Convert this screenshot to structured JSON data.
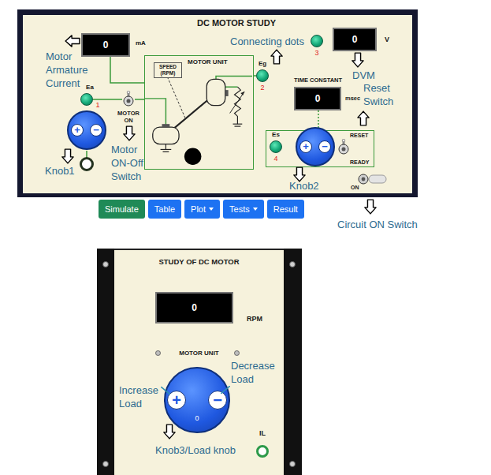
{
  "main_panel": {
    "title": "DC MOTOR STUDY",
    "current_meter": {
      "value": "0",
      "unit": "mA"
    },
    "terminals": [
      {
        "label": "Ea",
        "number": "1"
      },
      {
        "label": "Eg",
        "number": "2"
      },
      {
        "number": "3"
      },
      {
        "label": "Es",
        "number": "4"
      }
    ],
    "motor_switch": {
      "labels": [
        "MOTOR",
        "ON"
      ],
      "on": false
    },
    "armature_knob": {
      "plus": "+",
      "minus": "−"
    },
    "motor_unit": {
      "title": "MOTOR UNIT",
      "speed_label": [
        "SPEED",
        "(RPM)"
      ]
    },
    "dvm": {
      "value": "0",
      "unit": "V"
    },
    "time_constant": {
      "label": "TIME CONSTANT",
      "value": "0",
      "unit": "msec"
    },
    "field_knob": {
      "plus": "+",
      "minus": "−"
    },
    "reset_switch": {
      "labels": [
        "RESET",
        "READY"
      ],
      "on": false
    },
    "circuit_switch": {
      "label": "ON",
      "on": false
    }
  },
  "toolbar": [
    {
      "label": "Simulate",
      "dropdown": false,
      "color": "#1f8a57"
    },
    {
      "label": "Table",
      "dropdown": false,
      "color": "#1d72f2"
    },
    {
      "label": "Plot",
      "dropdown": true,
      "color": "#1d72f2"
    },
    {
      "label": "Tests",
      "dropdown": true,
      "color": "#1d72f2"
    },
    {
      "label": "Result",
      "dropdown": false,
      "color": "#1d72f2"
    }
  ],
  "load_panel": {
    "title": "STUDY OF DC MOTOR",
    "speed_meter": {
      "value": "0",
      "unit": "RPM"
    },
    "subtitle": "MOTOR UNIT",
    "load_knob": {
      "plus": "+",
      "minus": "−",
      "reading": "0"
    },
    "load_current_terminal": "IL"
  },
  "annotations": [
    {
      "text": "Motor Armature Current",
      "kind": "left"
    },
    {
      "text": "Knob1",
      "kind": "down"
    },
    {
      "text": "Motor ON-Off Switch",
      "kind": "down"
    },
    {
      "text": "Connecting dots",
      "kind": "up"
    },
    {
      "text": "DVM",
      "kind": "down"
    },
    {
      "text": "Reset Switch",
      "kind": "up"
    },
    {
      "text": "Knob2",
      "kind": "down"
    },
    {
      "text": "Circuit ON Switch",
      "kind": "down"
    },
    {
      "text": "Increase Load",
      "kind": "pointer"
    },
    {
      "text": "Decrease Load",
      "kind": "pointer"
    },
    {
      "text": "Knob3/Load knob",
      "kind": "down"
    }
  ]
}
